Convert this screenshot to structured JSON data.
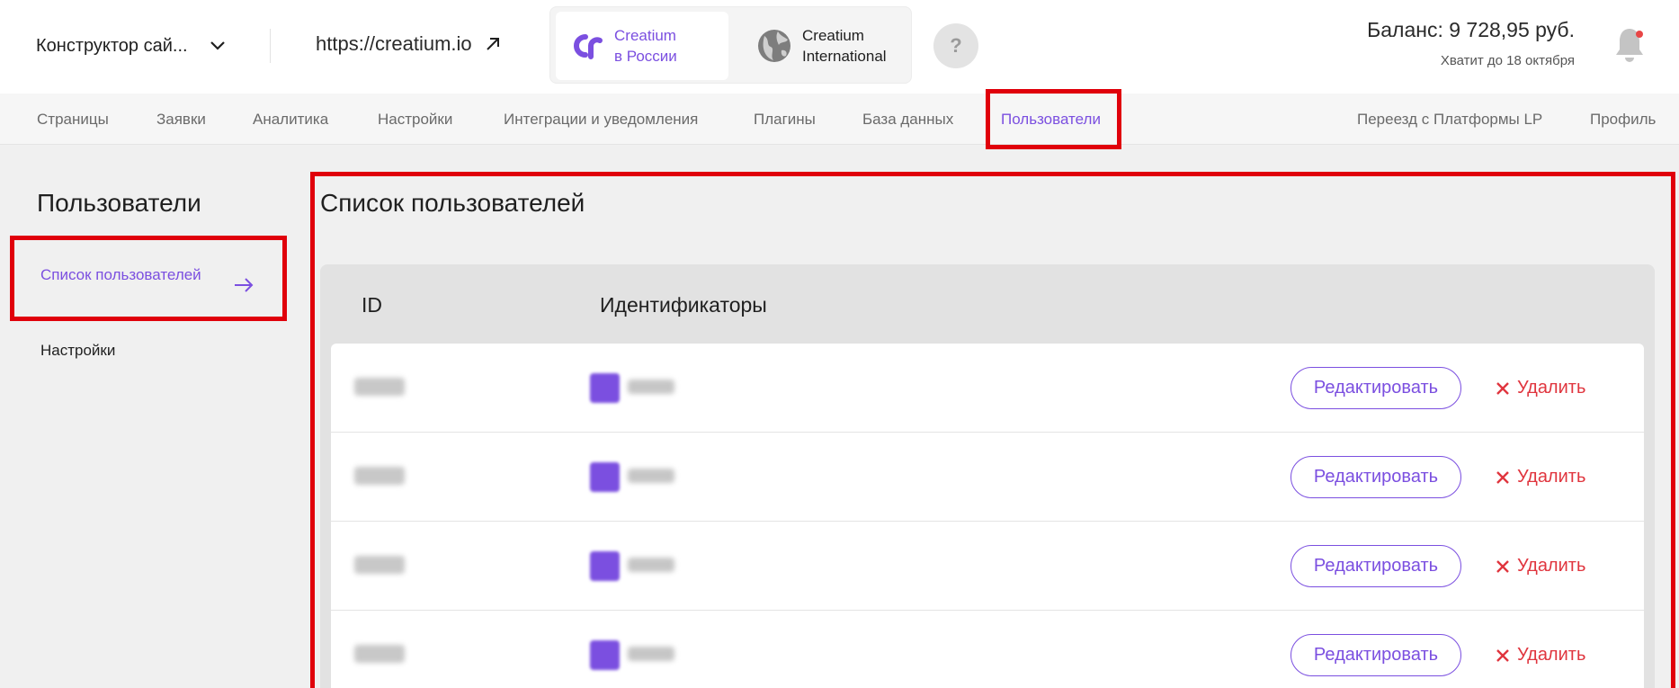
{
  "header": {
    "site_selector": {
      "label": "Конструктор сай...",
      "icon": "chevron-down-icon"
    },
    "site_url": {
      "label": "https://creatium.io",
      "icon": "external-link-icon"
    },
    "regions": [
      {
        "label_line1": "Creatium",
        "label_line2": "в России",
        "icon": "creatium-logo-icon",
        "selected": true
      },
      {
        "label_line1": "Creatium",
        "label_line2": "International",
        "icon": "globe-icon",
        "selected": false
      }
    ],
    "help_label": "?",
    "balance": "Баланс: 9 728,95 руб.",
    "balance_note": "Хватит до 18 октября",
    "bell_icon": "bell-icon"
  },
  "nav": {
    "items": [
      "Страницы",
      "Заявки",
      "Аналитика",
      "Настройки",
      "Интеграции и уведомления",
      "Плагины",
      "База данных",
      "Пользователи"
    ],
    "active": "Пользователи",
    "right_items": [
      "Переезд с Платформы LP",
      "Профиль"
    ]
  },
  "sidebar": {
    "title": "Пользователи",
    "items": [
      {
        "label": "Список пользователей",
        "active": true,
        "icon": "arrow-right-icon"
      },
      {
        "label": "Настройки",
        "active": false
      }
    ]
  },
  "main": {
    "title": "Список пользователей",
    "columns": [
      "ID",
      "Идентификаторы"
    ],
    "edit_label": "Редактировать",
    "delete_label": "Удалить",
    "row_count": 4
  },
  "colors": {
    "accent": "#7b4fe0",
    "danger": "#e0353e",
    "highlight": "#e0000b"
  }
}
